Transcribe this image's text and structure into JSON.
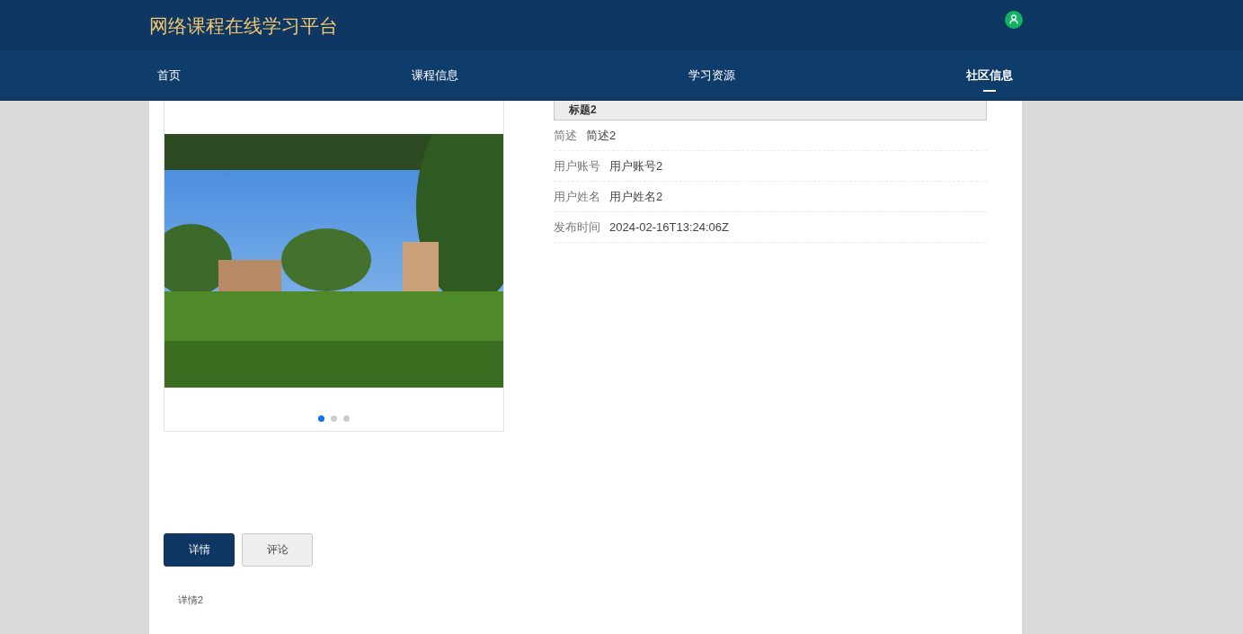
{
  "header": {
    "title": "网络课程在线学习平台"
  },
  "nav": [
    {
      "label": "首页",
      "selected": false
    },
    {
      "label": "课程信息",
      "selected": false
    },
    {
      "label": "学习资源",
      "selected": false
    },
    {
      "label": "社区信息",
      "selected": true
    }
  ],
  "carousel": {
    "slides": [
      {
        "selected": true
      },
      {
        "selected": false
      },
      {
        "selected": false
      }
    ]
  },
  "post": {
    "title": "标题2",
    "fields": [
      {
        "label": "简述",
        "value": "简述2"
      },
      {
        "label": "用户账号",
        "value": "用户账号2"
      },
      {
        "label": "用户姓名",
        "value": "用户姓名2"
      },
      {
        "label": "发布时间",
        "value": "2024-02-16T13:24:06Z"
      }
    ]
  },
  "tabs": [
    {
      "label": "详情",
      "selected": true
    },
    {
      "label": "评论",
      "selected": false
    }
  ],
  "detail": "详情2"
}
